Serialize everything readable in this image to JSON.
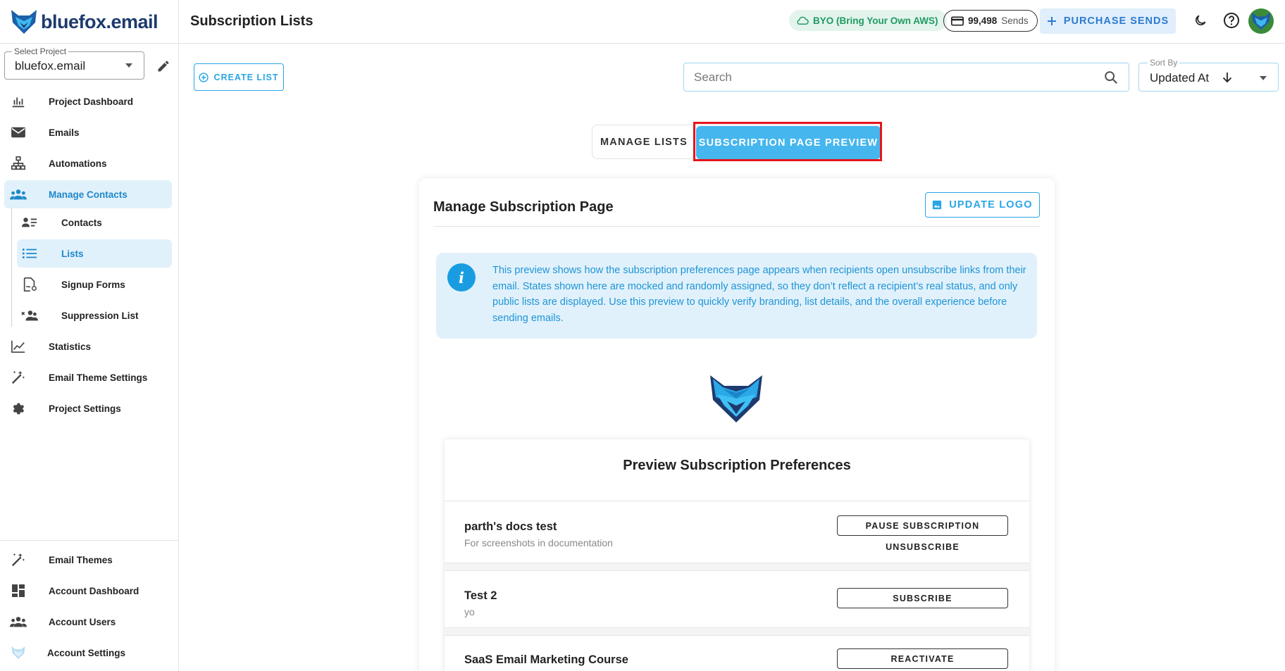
{
  "app": {
    "brand_name": "bluefox.email",
    "page_title": "Subscription Lists"
  },
  "project_select": {
    "label": "Select Project",
    "value": "bluefox.email"
  },
  "sidebar": {
    "items": [
      {
        "label": "Project Dashboard",
        "icon": "chart-icon"
      },
      {
        "label": "Emails",
        "icon": "mail-icon"
      },
      {
        "label": "Automations",
        "icon": "sitemap-icon"
      },
      {
        "label": "Manage Contacts",
        "icon": "contacts-icon"
      },
      {
        "label": "Contacts",
        "icon": "person-list-icon"
      },
      {
        "label": "Lists",
        "icon": "list-icon"
      },
      {
        "label": "Signup Forms",
        "icon": "signup-form-icon"
      },
      {
        "label": "Suppression List",
        "icon": "suppression-icon"
      },
      {
        "label": "Statistics",
        "icon": "line-chart-icon"
      },
      {
        "label": "Email Theme Settings",
        "icon": "magic-wand-icon"
      },
      {
        "label": "Project Settings",
        "icon": "gear-icon"
      }
    ],
    "bottom_items": [
      {
        "label": "Email Themes",
        "icon": "magic-wand-icon"
      },
      {
        "label": "Account Dashboard",
        "icon": "dashboard-icon"
      },
      {
        "label": "Account Users",
        "icon": "users-icon"
      },
      {
        "label": "Account Settings",
        "icon": "fox-icon"
      }
    ],
    "active_item": "Lists"
  },
  "header": {
    "byo_label": "BYO (Bring Your Own AWS)",
    "sends_count": "99,498",
    "sends_unit": "Sends",
    "purchase_label": "PURCHASE SENDS",
    "colors": {
      "byo_bg": "#e3f4ec",
      "byo_text": "#1f9a62",
      "purchase_text": "#2b7bd1"
    }
  },
  "toolbar": {
    "create_label": "CREATE LIST",
    "search_placeholder": "Search",
    "sort_label": "Sort By",
    "sort_value": "Updated At"
  },
  "view_toggle": {
    "manage_label": "MANAGE LISTS",
    "preview_label": "SUBSCRIPTION PAGE PREVIEW",
    "active": "SUBSCRIPTION PAGE PREVIEW"
  },
  "manage_page": {
    "title": "Manage Subscription Page",
    "update_logo_label": "UPDATE LOGO",
    "info_text": "This preview shows how the subscription preferences page appears when recipients open unsubscribe links from their email. States shown here are mocked and randomly assigned, so they don’t reflect a recipient’s real status, and only public lists are displayed. Use this preview to quickly verify branding, list details, and the overall experience before sending emails."
  },
  "preview": {
    "title": "Preview Subscription Preferences",
    "lists": [
      {
        "name": "parth's docs test",
        "description": "For screenshots in documentation",
        "primary_action": "PAUSE SUBSCRIPTION",
        "secondary_action": "UNSUBSCRIBE"
      },
      {
        "name": "Test 2",
        "description": "yo",
        "primary_action": "SUBSCRIBE"
      },
      {
        "name": "SaaS Email Marketing Course",
        "description": "",
        "primary_action": "REACTIVATE"
      }
    ]
  },
  "colors": {
    "accent": "#29a6e6",
    "active_tab": "#45b6ee",
    "highlight": "#e8141c"
  }
}
